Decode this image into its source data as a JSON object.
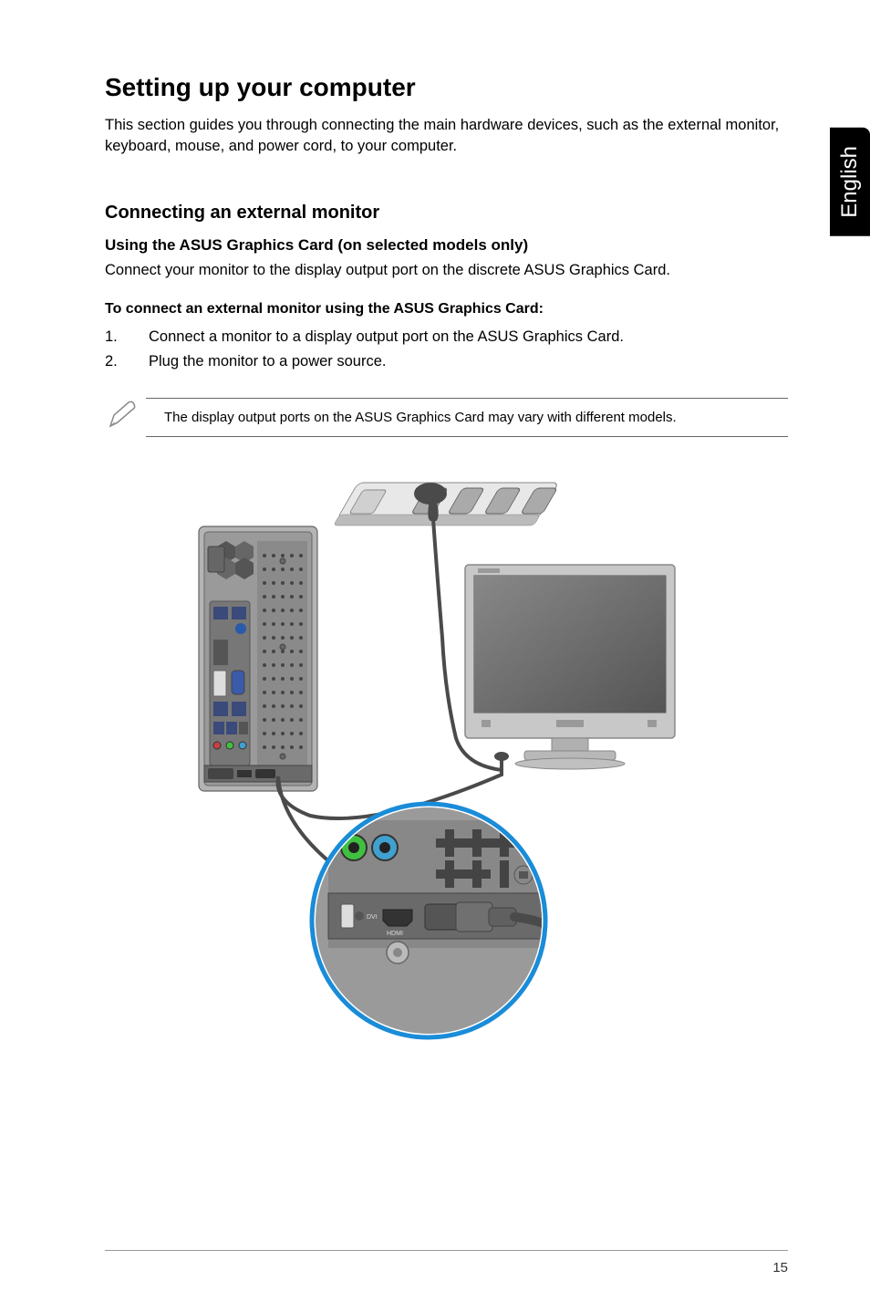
{
  "sideTab": "English",
  "heading": "Setting up your computer",
  "intro": "This section guides you through connecting the main hardware devices, such as the external monitor, keyboard, mouse, and power cord, to your computer.",
  "section1": {
    "title": "Connecting an external monitor",
    "subtitle": "Using the ASUS Graphics Card (on selected models only)",
    "body": "Connect your monitor to the display output port on the discrete ASUS Graphics Card.",
    "stepsTitle": "To connect an external monitor using the ASUS Graphics Card:",
    "steps": [
      {
        "num": "1.",
        "text": "Connect a monitor to a display output port on the ASUS Graphics Card."
      },
      {
        "num": "2.",
        "text": "Plug the monitor to a power source."
      }
    ],
    "note": "The display output ports on the ASUS Graphics Card may vary with different models."
  },
  "labels": {
    "dvi": "DVI",
    "hdmi": "HDMI"
  },
  "pageNumber": "15"
}
